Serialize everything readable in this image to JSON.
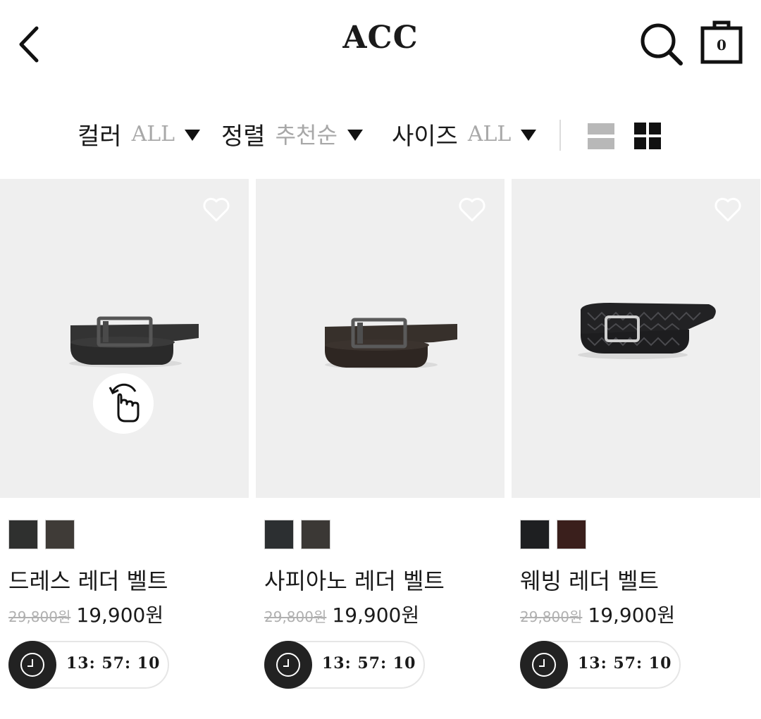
{
  "header": {
    "title": "ACC",
    "cart_count": "0",
    "icons": {
      "back": "chevron-left-icon",
      "search": "search-icon",
      "cart": "shopping-bag-icon"
    }
  },
  "filters": {
    "color": {
      "label": "컬러",
      "value": "ALL"
    },
    "sort": {
      "label": "정렬",
      "value": "추천순"
    },
    "size": {
      "label": "사이즈",
      "value": "ALL"
    },
    "view_modes": [
      "list-view-icon",
      "grid-view-icon"
    ],
    "active_view": "grid"
  },
  "products": [
    {
      "name": "드레스 레더 벨트",
      "original_price": "29,800원",
      "sale_price": "19,900원",
      "timer": "13: 57: 10",
      "swatches": [
        "#2f302f",
        "#3f3b37"
      ],
      "has_360": true
    },
    {
      "name": "사피아노 레더 벨트",
      "original_price": "29,800원",
      "sale_price": "19,900원",
      "timer": "13: 57: 10",
      "swatches": [
        "#2c2f31",
        "#3b3835"
      ],
      "has_360": false
    },
    {
      "name": "웨빙 레더 벨트",
      "original_price": "29,800원",
      "sale_price": "19,900원",
      "timer": "13: 57: 10",
      "swatches": [
        "#1e1f21",
        "#3a1f1c"
      ],
      "has_360": false
    }
  ],
  "colors": {
    "image_bg": "#efefef",
    "text": "#1a1a1a",
    "muted": "#a8a8a8"
  }
}
